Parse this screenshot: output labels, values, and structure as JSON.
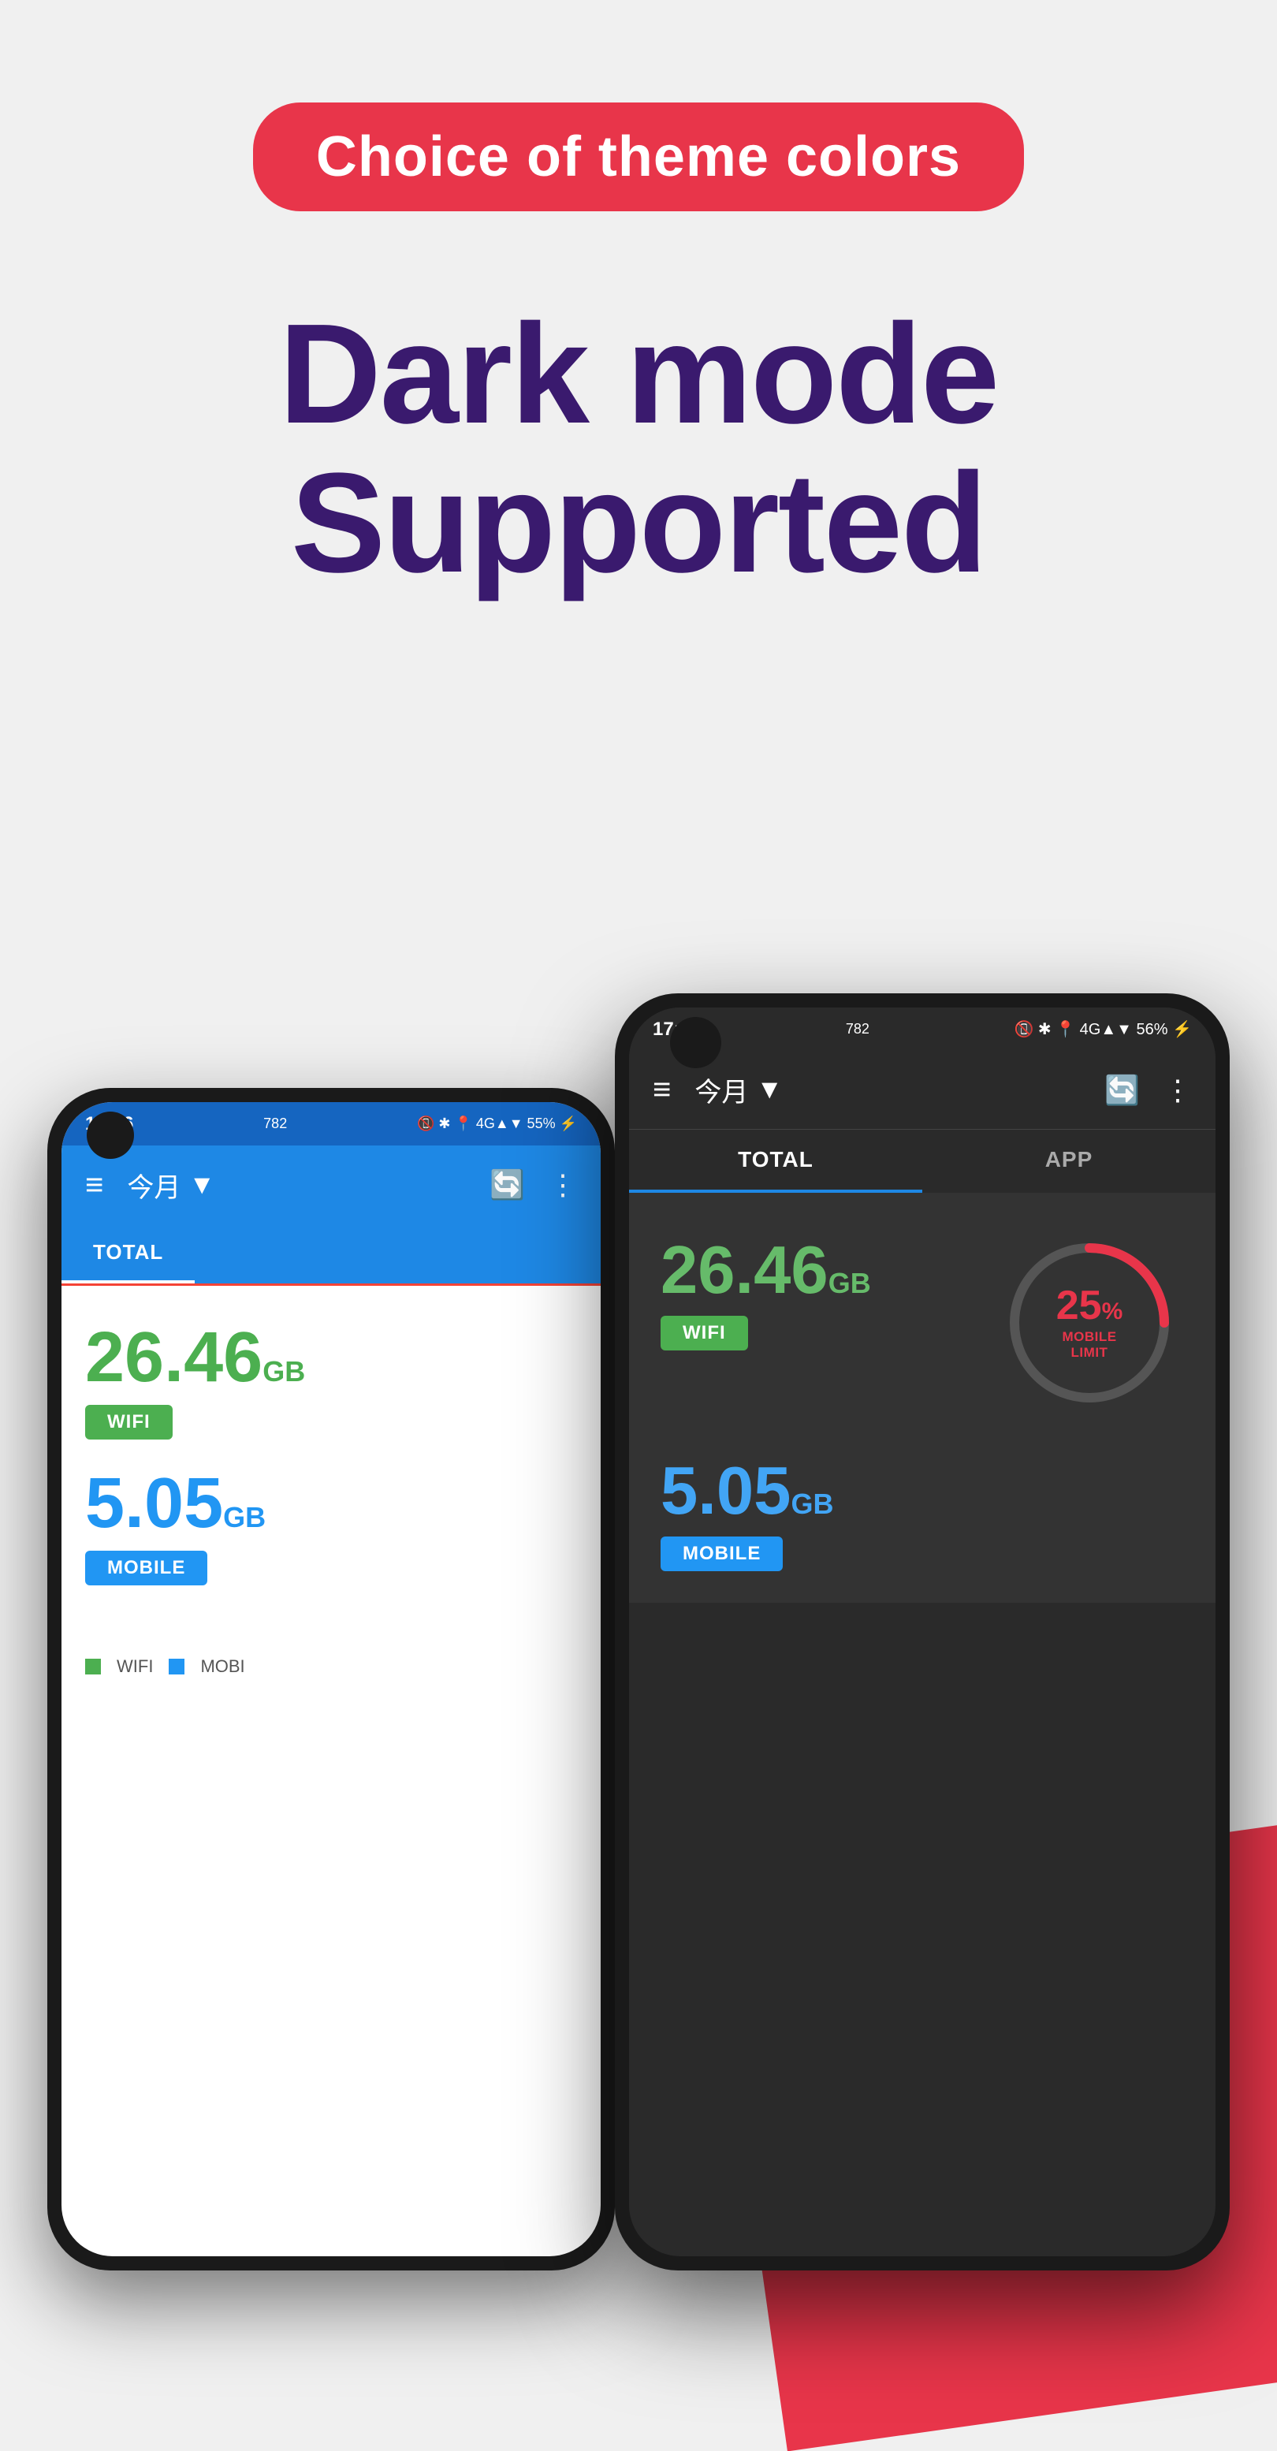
{
  "badge": {
    "text": "Choice of theme colors"
  },
  "heading": {
    "line1": "Dark mode",
    "line2": "Supported"
  },
  "phone_back": {
    "status_bar": {
      "time": "17:06",
      "mb": "782",
      "icons": "📵 ✱ 📍 Yo 4G▲▼ 55% ⚡"
    },
    "app_bar": {
      "month_label": "今月",
      "tab_total": "TOTAL"
    },
    "wifi_value": "26.46",
    "wifi_unit": "GB",
    "wifi_label": "WIFI",
    "mobile_value": "5.05",
    "mobile_unit": "GB",
    "mobile_label": "MOBILE",
    "legend_wifi": "WIFI",
    "legend_mobile": "MOBI"
  },
  "phone_front": {
    "status_bar": {
      "time": "17:09",
      "mb": "782",
      "icons": "📵 ✱ 📍 Yo 4G▲▼ 56% ⚡"
    },
    "app_bar": {
      "month_label": "今月"
    },
    "tab_total": "TOTAL",
    "tab_app": "APP",
    "wifi_value": "26.46",
    "wifi_unit": "GB",
    "wifi_label": "WIFI",
    "mobile_value": "5.05",
    "mobile_unit": "GB",
    "mobile_label": "MOBILE",
    "gauge": {
      "percent": "25",
      "percent_symbol": "%",
      "label": "MOBILE LIMIT"
    }
  },
  "colors": {
    "badge_bg": "#e8354a",
    "heading": "#3a1a6e",
    "bg": "#f0f0f0",
    "red_shape": "#e8354a"
  }
}
